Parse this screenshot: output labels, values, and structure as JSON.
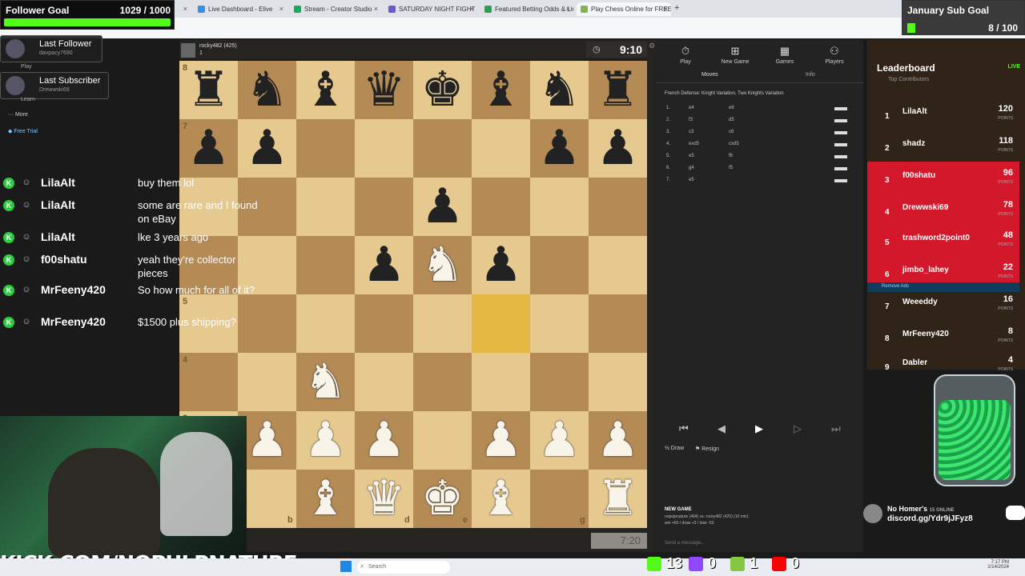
{
  "browser": {
    "tabs": [
      {
        "label": "",
        "color": "#2aa14a"
      },
      {
        "label": "Live Dashboard - Elive",
        "color": "#3a8ee6"
      },
      {
        "label": "Stream - Creator Studio",
        "color": "#1aa760"
      },
      {
        "label": "SATURDAY NIGHT FIGHT",
        "color": "#6a5acd"
      },
      {
        "label": "Featured Betting Odds & Lines",
        "color": "#2aa14a"
      },
      {
        "label": "Play Chess Online for FREE - 2",
        "color": "#81b64c"
      }
    ]
  },
  "overlay": {
    "follower_goal": {
      "label": "Follower Goal",
      "value": "1029 / 1000"
    },
    "sub_goal": {
      "label": "January Sub Goal",
      "value": "8 / 100"
    },
    "last_follower": {
      "title": "Last Follower",
      "name": "davpacy7690"
    },
    "last_subscriber": {
      "title": "Last Subscriber",
      "name": "Drewwski69"
    },
    "menu_play": "Play",
    "menu_learn": "Learn",
    "menu_more": "More",
    "free_trial": "Free Trial",
    "url_banner": "KICK.COM/NOPULPNATURE",
    "discord_title": "No Homer's",
    "discord_online": "15 ONLINE",
    "discord_link": "discord.gg/Ydr9jJFyz8",
    "remove_ads": "Remove Ads"
  },
  "chat": [
    {
      "name": "LilaAlt",
      "msg": "buy them lol"
    },
    {
      "name": "LilaAlt",
      "msg": "some are rare and I found on eBay"
    },
    {
      "name": "LilaAlt",
      "msg": "lke 3 years ago"
    },
    {
      "name": "f00shatu",
      "msg": "yeah they're collector pieces"
    },
    {
      "name": "MrFeeny420",
      "msg": "So how much for all of it?"
    },
    {
      "name": "MrFeeny420",
      "msg": "$1500 plus shipping?"
    }
  ],
  "game": {
    "opponent": "rocky482 (425)",
    "opp_rank": "1",
    "top_clock": "9:10",
    "bottom_clock": "7:20",
    "board": [
      [
        "r",
        "n",
        "b",
        "q",
        "k",
        "b",
        "n",
        "r"
      ],
      [
        "p",
        "p",
        "",
        "",
        "",
        "",
        "p",
        "p"
      ],
      [
        "",
        "",
        "",
        "",
        "p",
        "",
        "",
        ""
      ],
      [
        "",
        "",
        "",
        "p",
        "N",
        "p",
        "",
        ""
      ],
      [
        "",
        "",
        "",
        "",
        "",
        "",
        "",
        ""
      ],
      [
        "",
        "",
        "N",
        "",
        "",
        "",
        "",
        ""
      ],
      [
        "",
        "P",
        "P",
        "P",
        "",
        "P",
        "P",
        "P"
      ],
      [
        "",
        "",
        "B",
        "Q",
        "K",
        "B",
        "",
        "R"
      ]
    ],
    "highlight": "f4",
    "ranks": [
      "8",
      "7",
      "",
      "",
      "5",
      "4",
      "3",
      ""
    ],
    "files": [
      "",
      "b",
      "",
      "d",
      "e",
      "",
      "g",
      ""
    ]
  },
  "panel": {
    "nav": [
      "Play",
      "New Game",
      "Games",
      "Players"
    ],
    "tab_moves": "Moves",
    "tab_info": "Info",
    "opening": "French Defense: Knight Variation, Two Knights Variation",
    "moves": [
      {
        "n": "1.",
        "w": "e4",
        "b": "e6"
      },
      {
        "n": "2.",
        "w": "f3",
        "b": "d5"
      },
      {
        "n": "3.",
        "w": "c3",
        "b": "c6"
      },
      {
        "n": "4.",
        "w": "exd5",
        "b": "cxd5"
      },
      {
        "n": "5.",
        "w": "e5",
        "b": "f6"
      },
      {
        "n": "6.",
        "w": "g4",
        "b": "f5"
      },
      {
        "n": "7.",
        "w": "e5",
        "b": ""
      }
    ],
    "draw": "Draw",
    "resign": "Resign",
    "new_game_title": "NEW GAME",
    "new_game_line1": "nopulpnature (404) vs. rocky482 (425) (10 min)",
    "new_game_line2": "win +60 / draw +3 / lose -53",
    "send_placeholder": "Send a message..."
  },
  "leaderboard": {
    "title": "Leaderboard",
    "subtitle": "Top Contributors",
    "live": "LIVE",
    "points_label": "POINTS",
    "rows": [
      {
        "rank": "1",
        "name": "LilaAlt",
        "points": "120"
      },
      {
        "rank": "2",
        "name": "shadz",
        "points": "118"
      },
      {
        "rank": "3",
        "name": "f00shatu",
        "points": "96"
      },
      {
        "rank": "4",
        "name": "Drewwski69",
        "points": "78"
      },
      {
        "rank": "5",
        "name": "trashword2point0",
        "points": "48"
      },
      {
        "rank": "6",
        "name": "jimbo_lahey",
        "points": "22"
      },
      {
        "rank": "7",
        "name": "Weeeddy",
        "points": "16"
      },
      {
        "rank": "8",
        "name": "MrFeeny420",
        "points": "8"
      },
      {
        "rank": "9",
        "name": "Dabler",
        "points": "4"
      }
    ]
  },
  "counters": [
    {
      "icon": "kick-icon",
      "value": "13",
      "color": "#53fc18"
    },
    {
      "icon": "twitch-icon",
      "value": "0",
      "color": "#9146ff"
    },
    {
      "icon": "rumble-icon",
      "value": "1",
      "color": "#85c742"
    },
    {
      "icon": "youtube-icon",
      "value": "0",
      "color": "#ff0000"
    }
  ],
  "taskbar": {
    "search": "Search",
    "time": "7:17 PM",
    "date": "1/14/2024"
  }
}
